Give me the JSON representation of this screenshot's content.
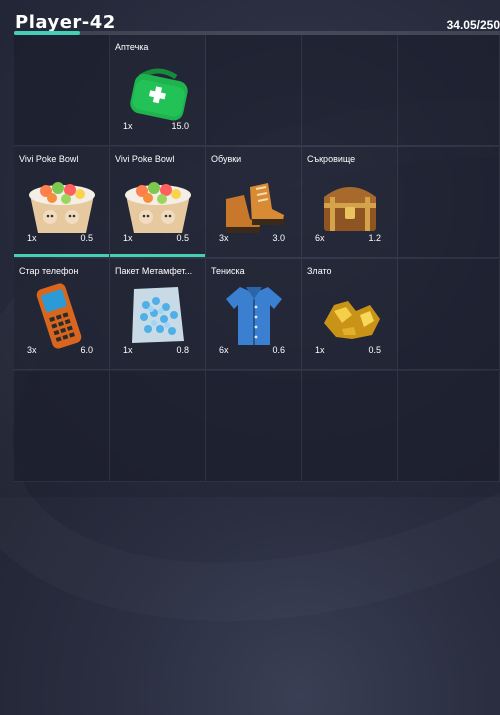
{
  "player": {
    "name": "Player-42"
  },
  "weight": {
    "text": "34.05/250",
    "fill_fraction": 0.136
  },
  "accent_color": "#43d0b4",
  "slots": [
    {
      "empty": true
    },
    {
      "name": "Аптечка",
      "qty": "1x",
      "weight": "15.0",
      "icon": "first-aid-kit-icon"
    },
    {
      "empty": true
    },
    {
      "empty": true
    },
    {
      "empty": true
    },
    {
      "name": "Vivi Poke Bowl",
      "qty": "1x",
      "weight": "0.5",
      "icon": "poke-bowl-icon",
      "durability": 1.0
    },
    {
      "name": "Vivi Poke Bowl",
      "qty": "1x",
      "weight": "0.5",
      "icon": "poke-bowl-icon",
      "durability": 1.0
    },
    {
      "name": "Обувки",
      "qty": "3x",
      "weight": "3.0",
      "icon": "boots-icon"
    },
    {
      "name": "Съкровище",
      "qty": "6x",
      "weight": "1.2",
      "icon": "treasure-chest-icon"
    },
    {
      "empty": true
    },
    {
      "name": "Стар телефон",
      "qty": "3x",
      "weight": "6.0",
      "icon": "old-phone-icon"
    },
    {
      "name": "Пакет Метамфет...",
      "qty": "1x",
      "weight": "0.8",
      "icon": "crystal-bag-icon"
    },
    {
      "name": "Тениска",
      "qty": "6x",
      "weight": "0.6",
      "icon": "shirt-icon"
    },
    {
      "name": "Злато",
      "qty": "1x",
      "weight": "0.5",
      "icon": "gold-nugget-icon"
    },
    {
      "empty": true
    },
    {
      "empty": true
    },
    {
      "empty": true
    },
    {
      "empty": true
    },
    {
      "empty": true
    },
    {
      "empty": true
    }
  ]
}
